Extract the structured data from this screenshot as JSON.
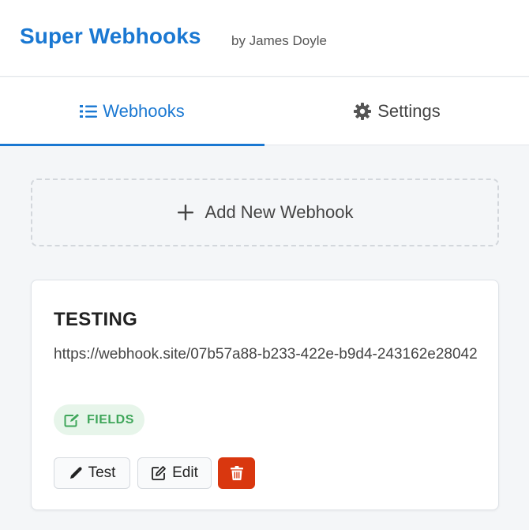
{
  "header": {
    "title": "Super Webhooks",
    "author": "by James Doyle"
  },
  "tabs": [
    {
      "label": "Webhooks",
      "icon": "list-icon",
      "active": true
    },
    {
      "label": "Settings",
      "icon": "gear-icon",
      "active": false
    }
  ],
  "add_webhook": {
    "label": "Add New Webhook",
    "icon": "plus-icon"
  },
  "webhooks": [
    {
      "name": "TESTING",
      "url": "https://webhook.site/07b57a88-b233-422e-b9d4-243162e28042",
      "badge": "FIELDS",
      "badge_icon": "edit-square-icon",
      "actions": {
        "test_label": "Test",
        "edit_label": "Edit",
        "delete_icon": "trash-icon"
      }
    }
  ],
  "colors": {
    "accent": "#1a78d2",
    "badge_bg": "#e7f5ea",
    "badge_text": "#3fa65a",
    "danger": "#d9370f"
  }
}
